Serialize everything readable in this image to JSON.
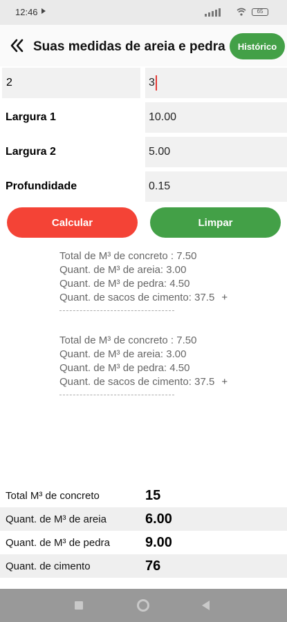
{
  "status": {
    "time": "12:46",
    "battery": "65"
  },
  "appbar": {
    "title": "Suas medidas de areia e pedra",
    "history_button": "Histórico"
  },
  "inputs": {
    "comprimento_1": "2",
    "comprimento_2": "3",
    "largura_1_label": "Largura 1",
    "largura_1_value": "10.00",
    "largura_2_label": "Largura 2",
    "largura_2_value": "5.00",
    "profundidade_label": "Profundidade",
    "profundidade_value": "0.15"
  },
  "buttons": {
    "calcular": "Calcular",
    "limpar": "Limpar"
  },
  "results": [
    {
      "concreto": "Total de M³ de concreto : 7.50",
      "areia": "Quant. de M³ de areia: 3.00",
      "pedra": "Quant. de M³ de pedra: 4.50",
      "cimento": "Quant. de sacos de cimento: 37.5",
      "plus": "+"
    },
    {
      "concreto": "Total de M³ de concreto : 7.50",
      "areia": "Quant. de M³ de areia: 3.00",
      "pedra": "Quant. de M³ de pedra: 4.50",
      "cimento": "Quant. de sacos de cimento: 37.5",
      "plus": "+"
    }
  ],
  "totals": [
    {
      "label": "Total M³ de concreto",
      "value": "15"
    },
    {
      "label": "Quant. de M³ de areia",
      "value": "6.00"
    },
    {
      "label": "Quant. de M³ de pedra",
      "value": "9.00"
    },
    {
      "label": "Quant. de cimento",
      "value": "76"
    }
  ],
  "colors": {
    "primary_green": "#43a047",
    "danger_red": "#f44336"
  }
}
